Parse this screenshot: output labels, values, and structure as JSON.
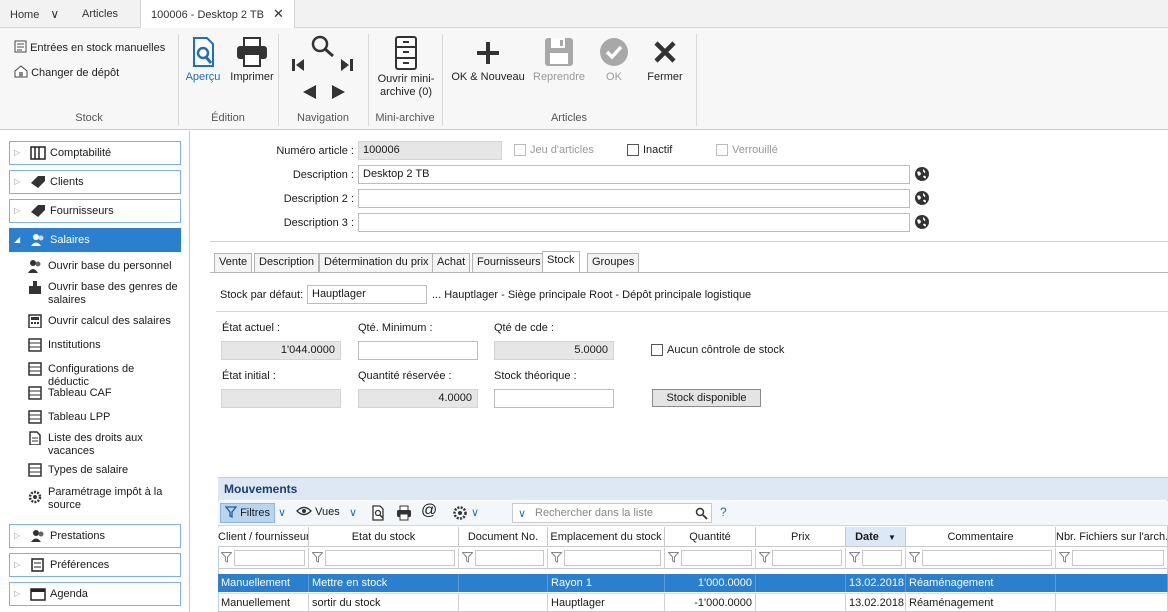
{
  "tabs": {
    "home": "Home",
    "articles": "Articles",
    "current": "100006 - Desktop 2 TB"
  },
  "ribbon": {
    "stock_group": {
      "label": "Stock",
      "manual_entries": "Entrées en stock manuelles",
      "change_depot": "Changer de dépôt"
    },
    "edition_group": {
      "label": "Édition",
      "preview": "Aperçu",
      "print": "Imprimer"
    },
    "navigation_group": {
      "label": "Navigation"
    },
    "mini_archive_group": {
      "label": "Mini-archive",
      "open_line1": "Ouvrir mini-",
      "open_line2": "archive (0)"
    },
    "articles_group": {
      "label": "Articles",
      "ok_new": "OK & Nouveau",
      "undo": "Reprendre",
      "ok": "OK",
      "close": "Fermer"
    }
  },
  "nav": {
    "categories": {
      "comptabilite": "Comptabilité",
      "clients": "Clients",
      "fournisseurs": "Fournisseurs",
      "salaires": "Salaires",
      "prestations": "Prestations",
      "preferences": "Préférences",
      "agenda": "Agenda"
    },
    "sub": {
      "personnel": "Ouvrir base du personnel",
      "genres": "Ouvrir base des genres de salaires",
      "calcul": "Ouvrir calcul des salaires",
      "institutions": "Institutions",
      "deductions": "Configurations de déductic",
      "caf": "Tableau CAF",
      "lpp": "Tableau LPP",
      "droits": "Liste des droits aux vacances",
      "types": "Types de salaire",
      "impot": "Paramétrage impôt à la source"
    }
  },
  "form": {
    "article_no_label": "Numéro article :",
    "article_no": "100006",
    "jeu": "Jeu d'articles",
    "inactif": "Inactif",
    "verrouille": "Verrouillé",
    "desc_label": "Description :",
    "desc_value": "Desktop 2 TB",
    "desc2_label": "Description 2 :",
    "desc2_value": "",
    "desc3_label": "Description 3 :",
    "desc3_value": ""
  },
  "inner_tabs": {
    "vente": "Vente",
    "description": "Description",
    "prix": "Détermination du prix",
    "achat": "Achat",
    "fournisseurs": "Fournisseurs",
    "stock": "Stock",
    "groupes": "Groupes"
  },
  "stock": {
    "default_label": "Stock par défaut:",
    "default_value": "Hauptlager",
    "default_desc": "... Hauptlager - Siège principale Root - Dépôt principale logistique",
    "etat_actuel_label": "État actuel :",
    "etat_actuel": "1'044.0000",
    "qte_min_label": "Qté. Minimum :",
    "qte_min": "",
    "qte_cde_label": "Qté de cde :",
    "qte_cde": "5.0000",
    "aucun_controle": "Aucun côntrole de stock",
    "etat_initial_label": "État initial :",
    "etat_initial": "",
    "qte_reservee_label": "Quantité réservée :",
    "qte_reservee": "4.0000",
    "stock_theorique_label": "Stock théorique :",
    "stock_theorique": "",
    "stock_dispo_button": "Stock disponible"
  },
  "mouvements": {
    "title": "Mouvements",
    "toolbar": {
      "filters": "Filtres",
      "views": "Vues",
      "search_placeholder": "Rechercher dans la liste",
      "help": "?"
    },
    "columns": {
      "client": "Client / fournisseur",
      "etat": "Etat du stock",
      "document": "Document No.",
      "emplacement": "Emplacement du stock",
      "quantite": "Quantité",
      "prix": "Prix",
      "date": "Date",
      "commentaire": "Commentaire",
      "fichiers": "Nbr. Fichiers sur l'arch."
    },
    "rows": [
      {
        "client": "Manuellement",
        "etat": "Mettre en stock",
        "document": "",
        "emplacement": "Rayon 1",
        "quantite": "1'000.0000",
        "prix": "",
        "date": "13.02.2018",
        "commentaire": "Réaménagement",
        "fichiers": ""
      },
      {
        "client": "Manuellement",
        "etat": "sortir du stock",
        "document": "",
        "emplacement": "Hauptlager",
        "quantite": "-1'000.0000",
        "prix": "",
        "date": "13.02.2018",
        "commentaire": "Réaménagement",
        "fichiers": ""
      }
    ]
  }
}
